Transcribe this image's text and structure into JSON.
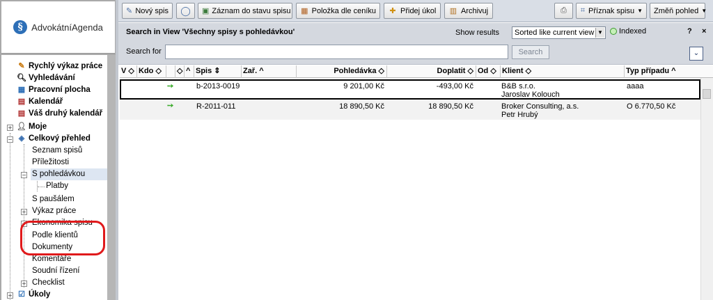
{
  "app": {
    "logo_text": "AdvokátníAgenda",
    "logo_letter": "§"
  },
  "toolbar": {
    "new_case": "Nový spis",
    "case_status_record": "Záznam do stavu spisu",
    "price_list_item": "Položka dle ceníku",
    "add_task": "Přidej úkol",
    "archive": "Archivuj",
    "flag": "Příznak spisu",
    "change_view": "Změň pohled"
  },
  "view": {
    "title": "Search in View 'Všechny spisy s pohledávkou'",
    "show_results": "Show results",
    "sort_value": "Sorted like current view",
    "indexed": "Indexed",
    "help": "?",
    "close": "×",
    "search_for": "Search for",
    "search_value": "",
    "search_button": "Search"
  },
  "nav": [
    {
      "label": "Rychlý výkaz práce",
      "bold": true,
      "icon": "quick-timesheet-icon"
    },
    {
      "label": "Vyhledávání",
      "bold": true,
      "icon": "magnifier-icon"
    },
    {
      "label": "Pracovní plocha",
      "bold": true,
      "icon": "desktop-icon"
    },
    {
      "label": "Kalendář",
      "bold": true,
      "icon": "calendar-icon"
    },
    {
      "label": "Váš druhý kalendář",
      "bold": true,
      "icon": "calendar-icon"
    },
    {
      "label": "Moje",
      "bold": true,
      "icon": "user-icon"
    },
    {
      "label": "Celkový přehled",
      "bold": true,
      "icon": "overview-icon"
    },
    {
      "label": "Seznam spisů",
      "bold": false
    },
    {
      "label": "Příležitosti",
      "bold": false
    },
    {
      "label": "S pohledávkou",
      "bold": false
    },
    {
      "label": "Platby",
      "bold": false
    },
    {
      "label": "S paušálem",
      "bold": false
    },
    {
      "label": "Výkaz práce",
      "bold": false
    },
    {
      "label": "Ekonomika spisu",
      "bold": false
    },
    {
      "label": "Podle klientů",
      "bold": false
    },
    {
      "label": "Dokumenty",
      "bold": false
    },
    {
      "label": "Komentáře",
      "bold": false
    },
    {
      "label": "Soudní řízení",
      "bold": false
    },
    {
      "label": "Checklist",
      "bold": false
    },
    {
      "label": "Úkoly",
      "bold": true,
      "icon": "tasks-icon"
    }
  ],
  "grid": {
    "columns": [
      {
        "label": "V ◇"
      },
      {
        "label": "Kdo ◇"
      },
      {
        "label": "◇"
      },
      {
        "label": "^"
      },
      {
        "label": "Spis ⇕"
      },
      {
        "label": "Zař. ^"
      },
      {
        "label": "Pohledávka ◇"
      },
      {
        "label": "Doplatit ◇"
      },
      {
        "label": "Od ◇"
      },
      {
        "label": "Klient ◇"
      },
      {
        "label": "Typ případu ^"
      }
    ],
    "rows": [
      {
        "spis": "b-2013-0019",
        "pohledavka": "9 201,00 Kč",
        "doplatit": "-493,00 Kč",
        "klient_line1": "B&B s.r.o.",
        "klient_line2": "Jaroslav Kolouch",
        "typ": "aaaa"
      },
      {
        "spis": "R-2011-011",
        "pohledavka": "18 890,50 Kč",
        "doplatit": "18 890,50 Kč",
        "klient_line1": "Broker Consulting, a.s.",
        "klient_line2": "Petr Hrubý",
        "typ": "O 6.770,50 Kč"
      }
    ]
  },
  "colors": {
    "annotation_ring": "#e0191b",
    "arrow": "#3bab2b",
    "logo": "#2d6fb7"
  }
}
